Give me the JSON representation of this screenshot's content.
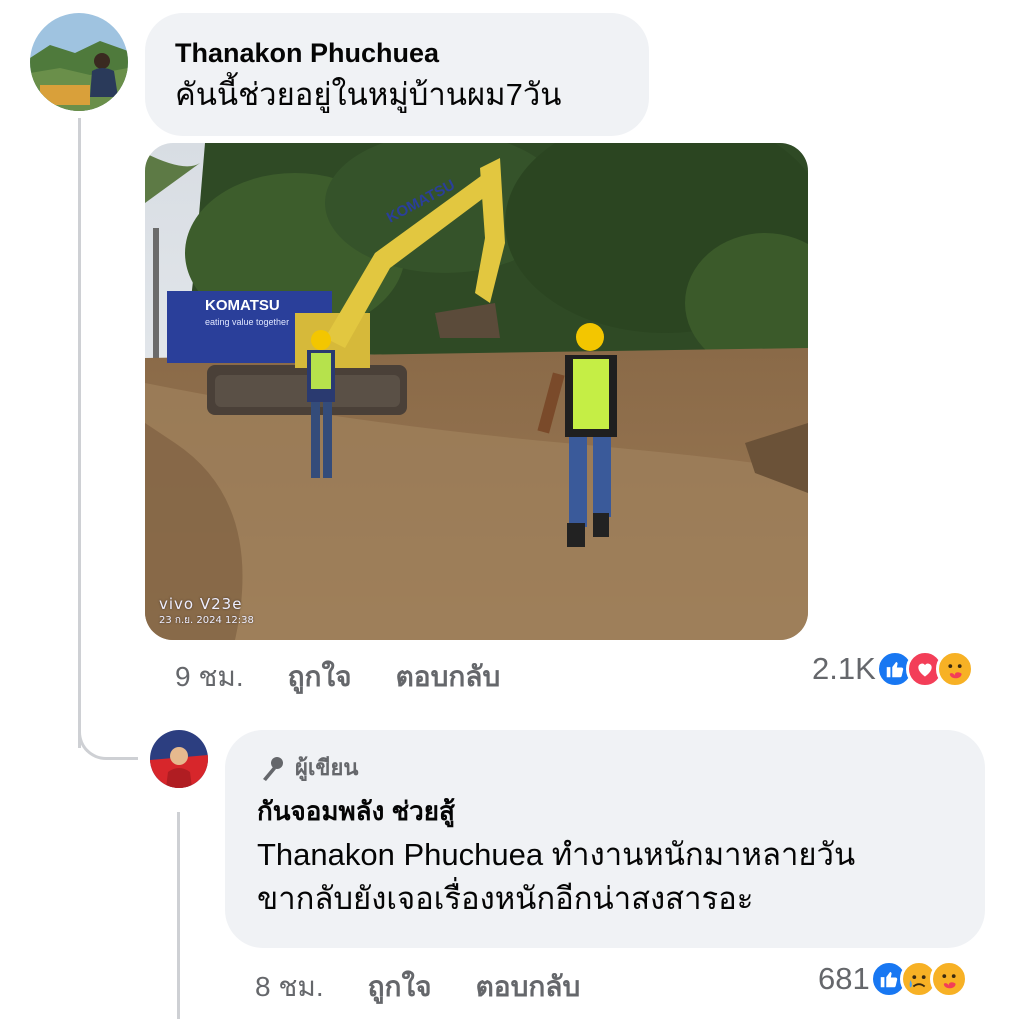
{
  "comment": {
    "author": "Thanakon Phuchuea",
    "text": "คันนี้ช่วยอยู่ในหมู่บ้านผม7วัน",
    "photo": {
      "alt": "Komatsu excavator working in a flooded muddy field with two workers in hard hats",
      "brand_arm": "KOMATSU",
      "banner_brand": "KOMATSU",
      "banner_slogan": "eating value together",
      "watermark_device": "vivo V23e",
      "watermark_date": "23 ก.ย. 2024 12:38"
    },
    "time": "9 ชม.",
    "like_label": "ถูกใจ",
    "reply_label": "ตอบกลับ",
    "reaction_count": "2.1K",
    "reactions": [
      "like-icon",
      "love-icon",
      "care-icon"
    ]
  },
  "reply": {
    "badge_label": "ผู้เขียน",
    "badge_icon": "microphone-icon",
    "author": "กันจอมพลัง ช่วยสู้",
    "text_line1": "Thanakon Phuchuea ทำงานหนักมาหลายวัน",
    "text_line2": "ขากลับยังเจอเรื่องหนักอีกน่าสงสารอะ",
    "time": "8 ชม.",
    "like_label": "ถูกใจ",
    "reply_label": "ตอบกลับ",
    "reaction_count": "681",
    "reactions": [
      "like-icon",
      "sad-icon",
      "care-icon"
    ]
  },
  "colors": {
    "bubble_bg": "#f0f2f5",
    "meta_text": "#65676b",
    "like_blue": "#1877f2",
    "love_red": "#f33e58",
    "emoji_yellow": "#f7b125",
    "thread_line": "#ced0d4"
  }
}
